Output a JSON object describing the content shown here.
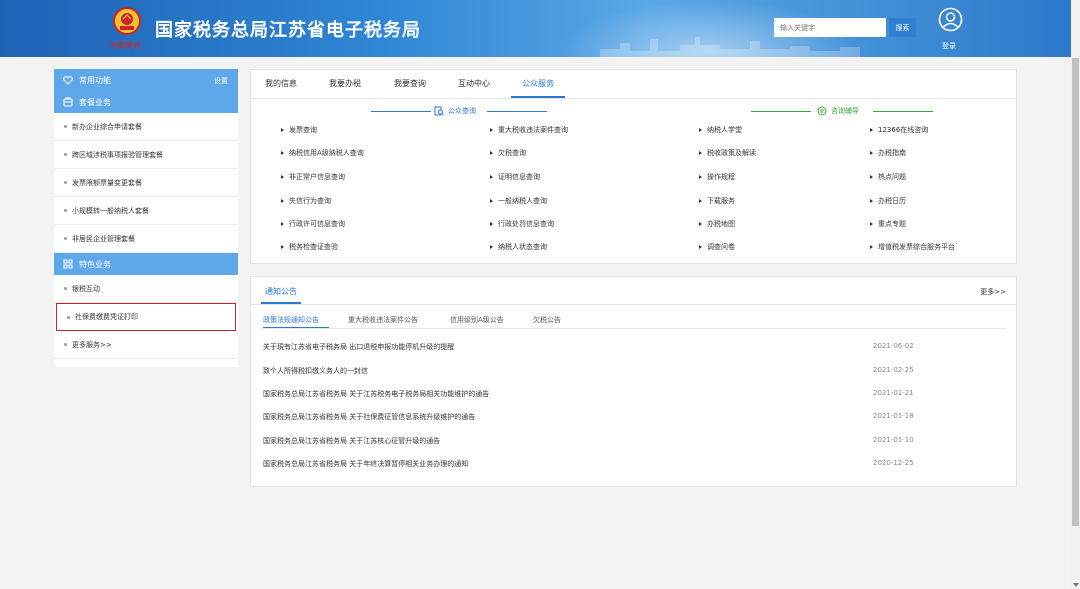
{
  "header": {
    "title": "国家税务总局江苏省电子税务局",
    "emblem_caption": "中国税务",
    "search_placeholder": "输入关键字",
    "search_button": "搜索",
    "login_label": "登录"
  },
  "sidebar": {
    "common_label": "常用功能",
    "settings_label": "设置",
    "package_label": "套餐业务",
    "package_items": [
      "新办企业综合申请套餐",
      "跨区域涉税事项报验管理套餐",
      "发票限额票量变更套餐",
      "小规模转一般纳税人套餐",
      "非居民企业管理套餐"
    ],
    "featured_label": "特色业务",
    "featured_items": [
      "银税互动",
      "社保费缴费凭证打印",
      "更多服务>>"
    ]
  },
  "tabs": [
    "我的信息",
    "我要办税",
    "我要查询",
    "互动中心",
    "公众服务"
  ],
  "active_tab": "公众服务",
  "public_query": {
    "title": "公众查询",
    "col1": [
      "发票查询",
      "纳税信用A级纳税人查询",
      "非正常户信息查询",
      "失信行为查询",
      "行政许可信息查询",
      "税务检查证查验"
    ],
    "col2": [
      "重大税收违法案件查询",
      "欠税查询",
      "证明信息查询",
      "一般纳税人查询",
      "行政处罚信息查询",
      "纳税人状态查询"
    ]
  },
  "consult": {
    "title": "咨询辅导",
    "col1": [
      "纳税人学堂",
      "税收政策及解读",
      "操作规程",
      "下载服务",
      "办税地图",
      "调查问卷"
    ],
    "col2": [
      "12366在线咨询",
      "办税指南",
      "热点问题",
      "办税日历",
      "重点专题",
      "增值税发票综合服务平台"
    ]
  },
  "notices": {
    "title": "通知公告",
    "more": "更多>>",
    "subtabs": [
      "政策法规通知公告",
      "重大税收违法案件公告",
      "信用级别A级公告",
      "欠税公告"
    ],
    "rows": [
      {
        "text": "关于現有江苏省电子税务局 出口退税申报功能停机升级的提醒",
        "date": "2021-06-02"
      },
      {
        "text": "致个人所得税扣缴义务人的一封信",
        "date": "2021-02-25"
      },
      {
        "text": "国家税务总局江苏省税务局 关于江苏税务电子税务局相关功能维护的通告",
        "date": "2021-01-21"
      },
      {
        "text": "国家税务总局江苏省税务局 关于社保费征管信息系统升级维护的通告",
        "date": "2021-01-18"
      },
      {
        "text": "国家税务总局江苏省税务局 关于江苏核心征管升级的通告",
        "date": "2021-01-10"
      },
      {
        "text": "国家税务总局江苏省税务局 关于年终决算暂停相关业务办理的通知",
        "date": "2020-12-25"
      }
    ]
  },
  "colors": {
    "accent": "#2a79cf",
    "sidebar_head": "#5da7ea",
    "consult_green": "#3aa63a",
    "highlight_box": "#c9242b"
  }
}
